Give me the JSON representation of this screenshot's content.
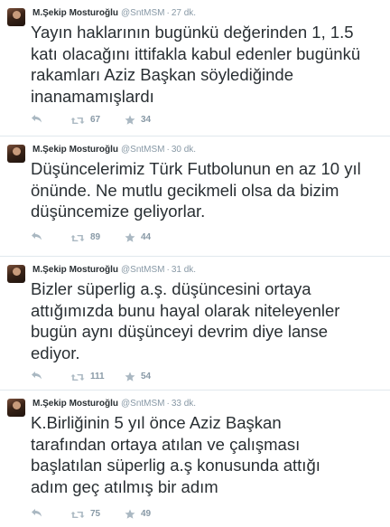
{
  "tweets": [
    {
      "author_name": "M.Şekip Mosturoğlu",
      "handle": "@SntMSM",
      "time": "27 dk.",
      "text": "Yayın haklarının bugünkü değerinden 1, 1.5\nkatı olacağını ittifakla kabul edenler bugünkü\nrakamları Aziz Başkan söylediğinde\ninanamamışlardı",
      "retweets": "67",
      "favorites": "34"
    },
    {
      "author_name": "M.Şekip Mosturoğlu",
      "handle": "@SntMSM",
      "time": "30 dk.",
      "text": "Düşüncelerimiz Türk Futbolunun en az 10 yıl\nönünde. Ne mutlu gecikmeli olsa da bizim\ndüşüncemize geliyorlar.",
      "retweets": "89",
      "favorites": "44"
    },
    {
      "author_name": "M.Şekip Mosturoğlu",
      "handle": "@SntMSM",
      "time": "31 dk.",
      "text": "Bizler süperlig a.ş. düşüncesini ortaya\nattığımızda bunu hayal olarak niteleyenler\nbugün aynı düşünceyi devrim diye lanse\nediyor.",
      "retweets": "111",
      "favorites": "54"
    },
    {
      "author_name": "M.Şekip Mosturoğlu",
      "handle": "@SntMSM",
      "time": "33 dk.",
      "text": "K.Birliğinin 5 yıl önce Aziz Başkan\ntarafından ortaya atılan ve çalışması\nbaşlatılan süperlig a.ş konusunda attığı\nadım geç atılmış bir adım",
      "retweets": "75",
      "favorites": "49"
    }
  ],
  "separator": "·",
  "icons": {
    "reply": "reply-icon",
    "retweet": "retweet-icon",
    "favorite": "star-icon"
  },
  "colors": {
    "text": "#292f33",
    "meta": "#8899a6",
    "divider": "#e1e8ed",
    "icon": "#aab8c2"
  }
}
